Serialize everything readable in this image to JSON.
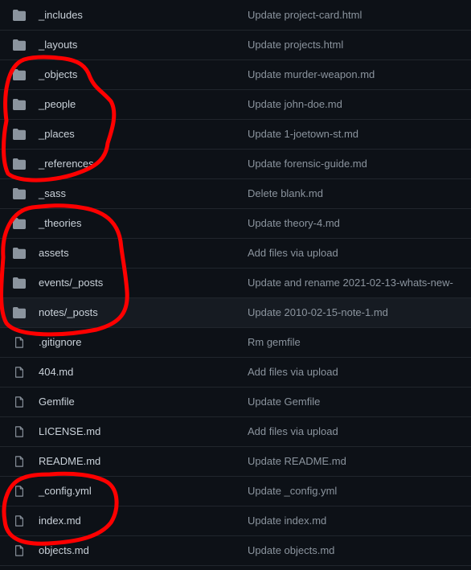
{
  "files": [
    {
      "type": "dir",
      "name": "_includes",
      "commit": "Update project-card.html"
    },
    {
      "type": "dir",
      "name": "_layouts",
      "commit": "Update projects.html"
    },
    {
      "type": "dir",
      "name": "_objects",
      "commit": "Update murder-weapon.md"
    },
    {
      "type": "dir",
      "name": "_people",
      "commit": "Update john-doe.md"
    },
    {
      "type": "dir",
      "name": "_places",
      "commit": "Update 1-joetown-st.md"
    },
    {
      "type": "dir",
      "name": "_references",
      "commit": "Update forensic-guide.md"
    },
    {
      "type": "dir",
      "name": "_sass",
      "commit": "Delete blank.md"
    },
    {
      "type": "dir",
      "name": "_theories",
      "commit": "Update theory-4.md"
    },
    {
      "type": "dir",
      "name": "assets",
      "commit": "Add files via upload"
    },
    {
      "type": "dir",
      "name": "events/_posts",
      "commit": "Update and rename 2021-02-13-whats-new-"
    },
    {
      "type": "dir",
      "name": "notes/_posts",
      "commit": "Update 2010-02-15-note-1.md"
    },
    {
      "type": "file",
      "name": ".gitignore",
      "commit": "Rm gemfile"
    },
    {
      "type": "file",
      "name": "404.md",
      "commit": "Add files via upload"
    },
    {
      "type": "file",
      "name": "Gemfile",
      "commit": "Update Gemfile"
    },
    {
      "type": "file",
      "name": "LICENSE.md",
      "commit": "Add files via upload"
    },
    {
      "type": "file",
      "name": "README.md",
      "commit": "Update README.md"
    },
    {
      "type": "file",
      "name": "_config.yml",
      "commit": "Update _config.yml"
    },
    {
      "type": "file",
      "name": "index.md",
      "commit": "Update index.md"
    },
    {
      "type": "file",
      "name": "objects.md",
      "commit": "Update objects.md"
    }
  ],
  "colors": {
    "background": "#0d1117",
    "row_hover": "#161b22",
    "divider": "#21262d",
    "icon": "#8b949e",
    "name_text": "#c9d1d9",
    "commit_text": "#8b949e",
    "annotation": "#ff0000"
  },
  "icons": {
    "dir": "folder-icon",
    "file": "file-icon"
  }
}
